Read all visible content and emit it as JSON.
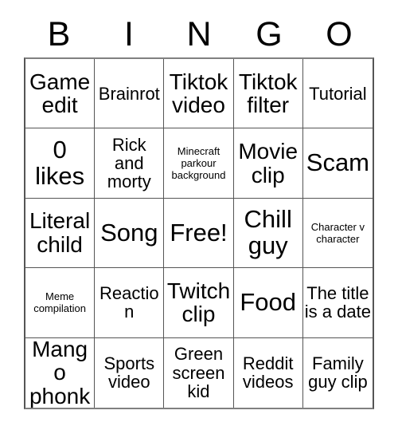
{
  "card": {
    "header_letters": [
      "B",
      "I",
      "N",
      "G",
      "O"
    ],
    "columns": 5,
    "rows": 5,
    "background_color": "#ffffff",
    "text_color": "#000000",
    "border_color": "#555555",
    "cells": [
      {
        "text": "Game edit",
        "size": "lg"
      },
      {
        "text": "Brainrot",
        "size": "md"
      },
      {
        "text": "Tiktok video",
        "size": "lg"
      },
      {
        "text": "Tiktok filter",
        "size": "lg"
      },
      {
        "text": "Tutorial",
        "size": "md"
      },
      {
        "text": "0 likes",
        "size": "xl"
      },
      {
        "text": "Rick and morty",
        "size": "md"
      },
      {
        "text": "Minecraft parkour background",
        "size": "xs"
      },
      {
        "text": "Movie clip",
        "size": "lg"
      },
      {
        "text": "Scam",
        "size": "xl"
      },
      {
        "text": "Literal child",
        "size": "lg"
      },
      {
        "text": "Song",
        "size": "xl"
      },
      {
        "text": "Free!",
        "size": "xl"
      },
      {
        "text": "Chill guy",
        "size": "xl"
      },
      {
        "text": "Character v character",
        "size": "xs"
      },
      {
        "text": "Meme compilation",
        "size": "xs"
      },
      {
        "text": "Reaction",
        "size": "md"
      },
      {
        "text": "Twitch clip",
        "size": "lg"
      },
      {
        "text": "Food",
        "size": "xl"
      },
      {
        "text": "The title is a date",
        "size": "md"
      },
      {
        "text": "Mango phonk",
        "size": "lg"
      },
      {
        "text": "Sports video",
        "size": "md"
      },
      {
        "text": "Green screen kid",
        "size": "md"
      },
      {
        "text": "Reddit videos",
        "size": "md"
      },
      {
        "text": "Family guy clip",
        "size": "md"
      }
    ]
  }
}
